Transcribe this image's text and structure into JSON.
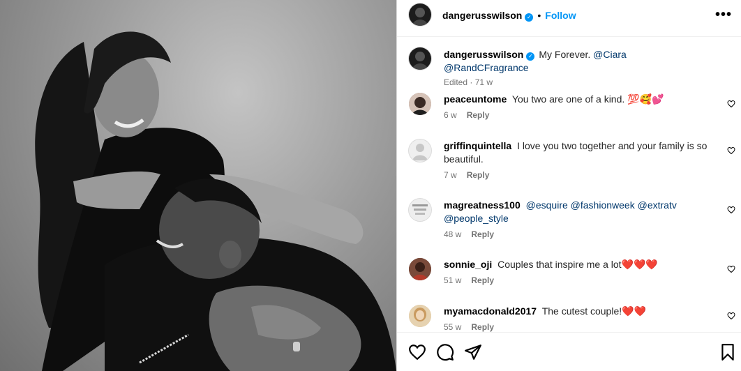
{
  "post": {
    "username": "dangerusswilson",
    "verified": true,
    "follow_label": "Follow",
    "dot": "•",
    "more_label": "•••"
  },
  "caption": {
    "username": "dangerusswilson",
    "text": "My Forever.",
    "mentions": [
      "@Ciara",
      "@RandCFragrance"
    ],
    "edited": "Edited",
    "time": "71 w"
  },
  "comments": [
    {
      "username": "peaceuntome",
      "text": "You two are one of a kind. 💯🥰💕",
      "time": "6 w",
      "reply": "Reply"
    },
    {
      "username": "griffinquintella",
      "text": "I love you two together and your family is so beautiful.",
      "time": "7 w",
      "reply": "Reply"
    },
    {
      "username": "magreatness100",
      "text": "",
      "mentions": [
        "@esquire",
        "@fashionweek",
        "@extratv",
        "@people_style"
      ],
      "time": "48 w",
      "reply": "Reply"
    },
    {
      "username": "sonnie_oji",
      "text": "Couples that inspire me a lot❤️❤️❤️",
      "time": "51 w",
      "reply": "Reply"
    },
    {
      "username": "myamacdonald2017",
      "text": "The cutest couple!❤️❤️",
      "time": "55 w",
      "reply": "Reply"
    }
  ],
  "actions": {
    "like_icon": "heart-outline-icon",
    "comment_icon": "comment-bubble-icon",
    "share_icon": "paper-plane-icon",
    "save_icon": "bookmark-icon"
  },
  "colors": {
    "link_blue": "#0095f6",
    "mention": "#00376b",
    "secondary_text": "#737373",
    "border": "#dbdbdb"
  }
}
